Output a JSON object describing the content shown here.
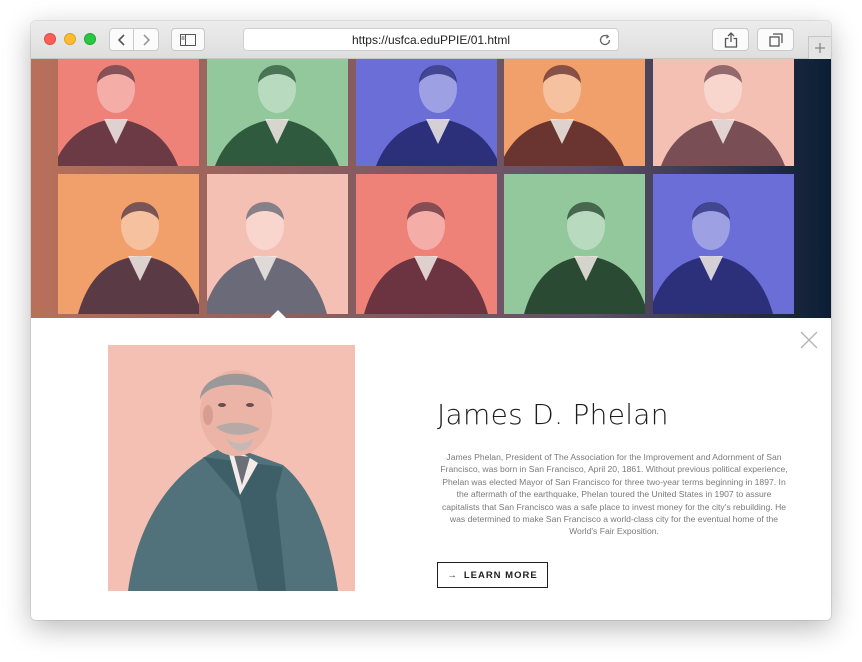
{
  "browser": {
    "url": "https://usfca.eduPPIE/01.html"
  },
  "colors": {
    "salmon": "#ee8278",
    "green": "#93c89d",
    "blue": "#6a6ed6",
    "orange": "#f1a06c",
    "pink": "#f4c0b4",
    "navy": "#0b1e35"
  },
  "hero": {
    "portraits": [
      {
        "bg": "#ee8278",
        "tone": "#6b3a45"
      },
      {
        "bg": "#93c89d",
        "tone": "#2f5a3d"
      },
      {
        "bg": "#6a6ed6",
        "tone": "#2c2f7a"
      },
      {
        "bg": "#f1a06c",
        "tone": "#6a3530"
      },
      {
        "bg": "#f4c0b4",
        "tone": "#7a4e55"
      },
      {
        "bg": "#f1a06c",
        "tone": "#5a3a45"
      },
      {
        "bg": "#f4c0b4",
        "tone": "#6a6a78"
      },
      {
        "bg": "#ee8278",
        "tone": "#6b3440"
      },
      {
        "bg": "#93c89d",
        "tone": "#2a4a33"
      },
      {
        "bg": "#6a6ed6",
        "tone": "#2c2f7a"
      }
    ]
  },
  "detail": {
    "name": "James D. Phelan",
    "bio": "James Phelan, President of The Association for the Improvement and Adornment of San Francisco, was born in San Francisco, April 20, 1861. Without previous political experience, Phelan was elected Mayor of San Francisco for three two-year terms beginning in 1897. In the aftermath of the earthquake, Phelan toured the United States in 1907 to assure capitalists that San Francisco was a safe place to invest money for the city's rebuilding. He was determined to make San Francisco a world-class city for the eventual home of the World's Fair Exposition.",
    "cta_arrow": "→",
    "cta_label": "LEARN MORE"
  }
}
